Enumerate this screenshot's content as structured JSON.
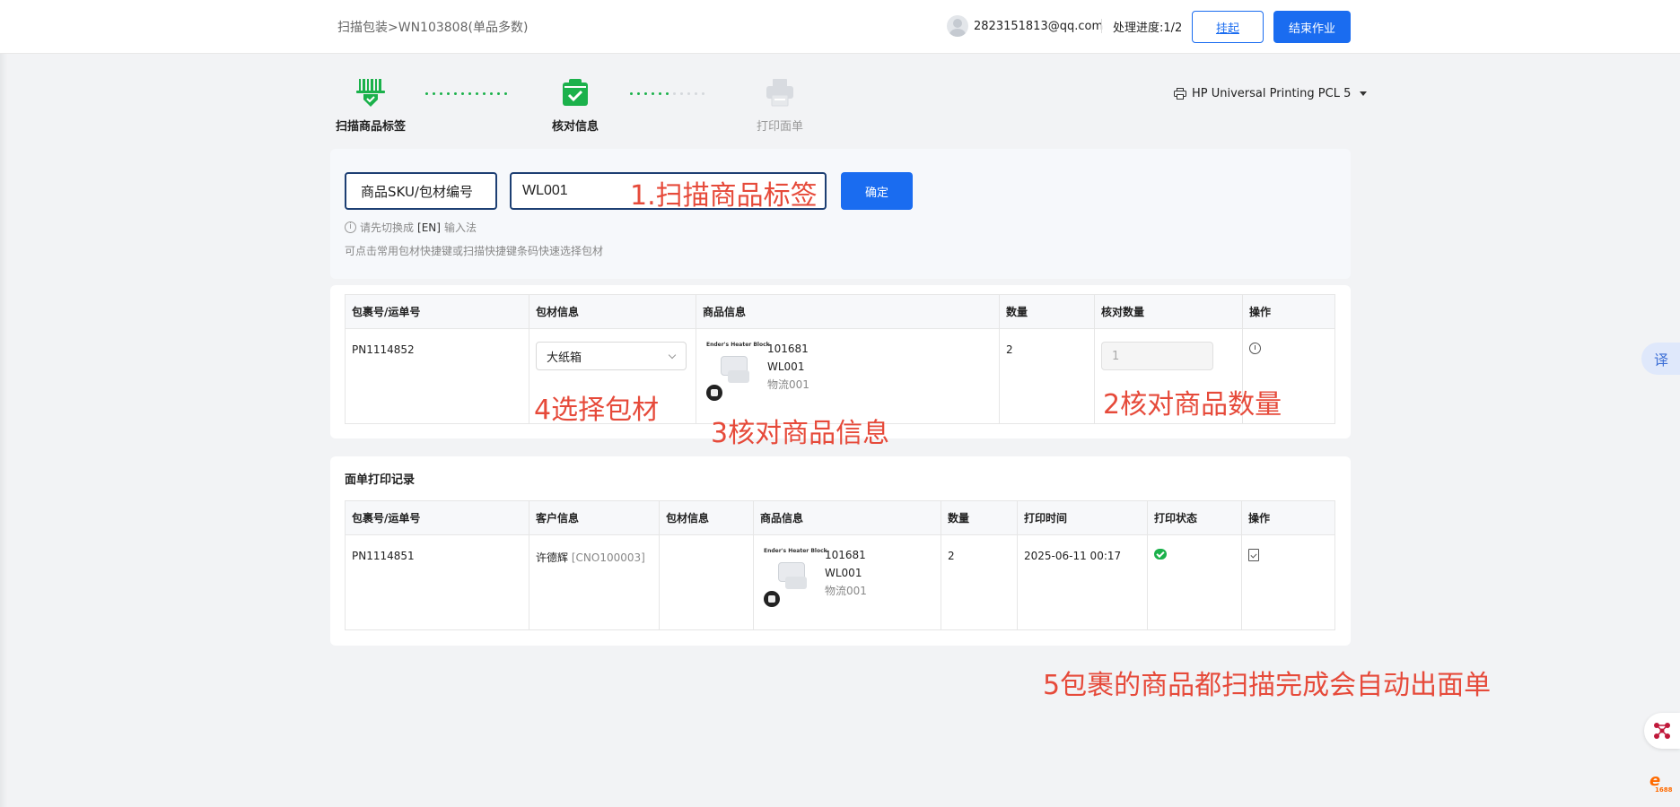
{
  "header": {
    "breadcrumb": "扫描包装>WN103808(单品多数)",
    "user_email": "2823151813@qq.com",
    "progress": "处理进度:1/2",
    "hang_button": "挂起",
    "finish_button": "结束作业"
  },
  "steps": [
    {
      "label": "扫描商品标签",
      "state": "done",
      "icon": "barcode-scan-icon"
    },
    {
      "label": "核对信息",
      "state": "done",
      "icon": "clipboard-check-icon"
    },
    {
      "label": "打印面单",
      "state": "todo",
      "icon": "printer-icon"
    }
  ],
  "printer": {
    "name": "HP Universal Printing PCL 5",
    "icon": "printer-icon"
  },
  "scan": {
    "mode": "商品SKU/包材编号",
    "input_value": "WL001",
    "confirm": "确定",
    "hint_prefix": "请先切换成",
    "hint_em": "[EN]",
    "hint_suffix": "输入法",
    "hint2": "可点击常用包材快捷键或扫描快捷键条码快速选择包材"
  },
  "annotations": {
    "a1": "1.扫描商品标签",
    "a2": "2核对商品数量",
    "a3": "3核对商品信息",
    "a4": "4选择包材",
    "a5": "5包裹的商品都扫描完成会自动出面单"
  },
  "current_table": {
    "headers": [
      "包裹号/运单号",
      "包材信息",
      "商品信息",
      "数量",
      "核对数量",
      "操作"
    ],
    "row": {
      "package_no": "PN1114852",
      "packing_material": "大纸箱",
      "product_brand": "Ender's Heater Block",
      "product_id": "101681",
      "sku": "WL001",
      "logistics": "物流001",
      "qty": "2",
      "checked_qty": "1"
    }
  },
  "record": {
    "title": "面单打印记录",
    "headers": [
      "包裹号/运单号",
      "客户信息",
      "包材信息",
      "商品信息",
      "数量",
      "打印时间",
      "打印状态",
      "操作"
    ],
    "row": {
      "package_no": "PN1114851",
      "customer_name": "许德辉",
      "customer_code": "[CNO100003]",
      "product_brand": "Ender's Heater Block",
      "product_id": "101681",
      "sku": "WL001",
      "logistics": "物流001",
      "qty": "2",
      "print_time": "2025-06-11 00:17"
    }
  },
  "floating": {
    "translate": "译",
    "badge_1688": "1688"
  },
  "colors": {
    "primary": "#1a6cf0",
    "success": "#1bb14b",
    "annotation": "#e64a3a"
  }
}
